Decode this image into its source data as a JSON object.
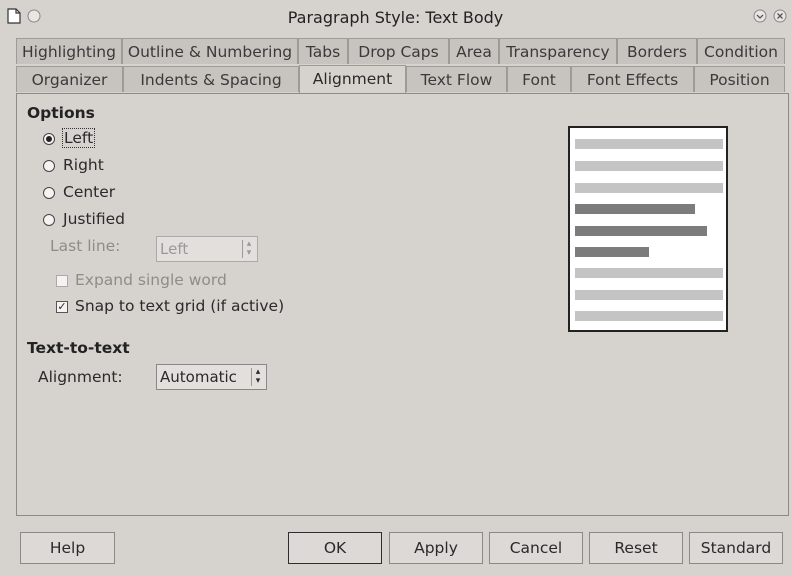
{
  "window": {
    "title": "Paragraph Style: Text Body"
  },
  "tabs_row1": [
    "Highlighting",
    "Outline & Numbering",
    "Tabs",
    "Drop Caps",
    "Area",
    "Transparency",
    "Borders",
    "Condition"
  ],
  "tabs_row2": [
    "Organizer",
    "Indents & Spacing",
    "Alignment",
    "Text Flow",
    "Font",
    "Font Effects",
    "Position"
  ],
  "active_tab": "Alignment",
  "options": {
    "heading": "Options",
    "radios": [
      {
        "label": "Left",
        "checked": true
      },
      {
        "label": "Right",
        "checked": false
      },
      {
        "label": "Center",
        "checked": false
      },
      {
        "label": "Justified",
        "checked": false
      }
    ],
    "last_line_label": "Last line:",
    "last_line_value": "Left",
    "expand_single_word": {
      "label": "Expand single word",
      "checked": false,
      "enabled": false
    },
    "snap_to_grid": {
      "label": "Snap to text grid (if active)",
      "checked": true,
      "enabled": true
    }
  },
  "text_to_text": {
    "heading": "Text-to-text",
    "alignment_label": "Alignment:",
    "alignment_value": "Automatic"
  },
  "buttons": {
    "help": "Help",
    "ok": "OK",
    "apply": "Apply",
    "cancel": "Cancel",
    "reset": "Reset",
    "standard": "Standard"
  }
}
